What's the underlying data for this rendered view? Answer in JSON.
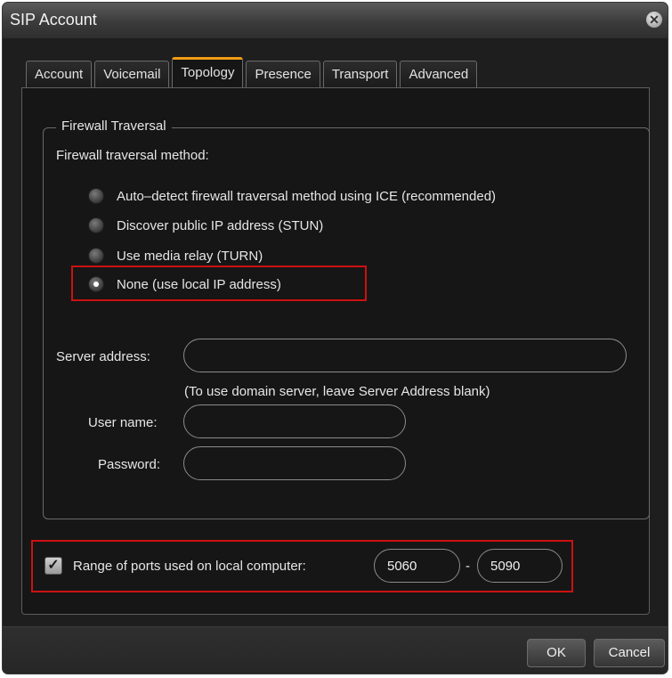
{
  "window": {
    "title": "SIP Account"
  },
  "tabs": [
    {
      "label": "Account"
    },
    {
      "label": "Voicemail"
    },
    {
      "label": "Topology",
      "active": true
    },
    {
      "label": "Presence"
    },
    {
      "label": "Transport"
    },
    {
      "label": "Advanced"
    }
  ],
  "firewall": {
    "group_title": "Firewall Traversal",
    "method_label": "Firewall traversal method:",
    "options": [
      {
        "label": "Auto–detect firewall traversal method using ICE (recommended)",
        "checked": false
      },
      {
        "label": "Discover public IP address (STUN)",
        "checked": false
      },
      {
        "label": "Use media relay (TURN)",
        "checked": false
      },
      {
        "label": "None (use local IP address)",
        "checked": true
      }
    ],
    "server_address_label": "Server address:",
    "server_address_value": "",
    "server_hint": "(To use domain server, leave Server Address blank)",
    "username_label": "User name:",
    "username_value": "",
    "password_label": "Password:",
    "password_value": ""
  },
  "ports": {
    "checked": true,
    "label": "Range of ports used on local computer:",
    "from": "5060",
    "separator": "-",
    "to": "5090"
  },
  "buttons": {
    "ok": "OK",
    "cancel": "Cancel"
  },
  "colors": {
    "active_tab_accent": "#f39b16",
    "highlight": "#cc1111",
    "background": "#161616"
  },
  "icons": {
    "close": "close-icon",
    "check": "checkmark-icon"
  }
}
